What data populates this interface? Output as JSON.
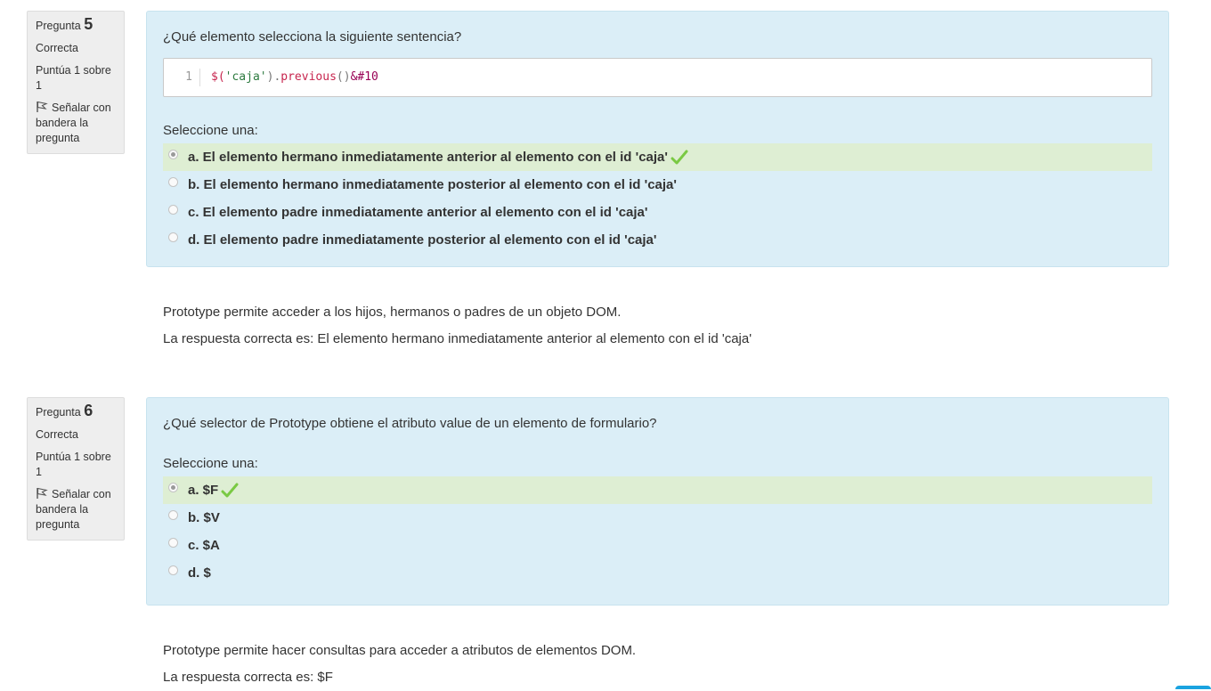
{
  "questions": [
    {
      "label": "Pregunta",
      "number": "5",
      "state": "Correcta",
      "grade": "Puntúa 1 sobre 1",
      "flag_label": "Señalar con bandera la pregunta",
      "text": "¿Qué elemento selecciona la siguiente sentencia?",
      "code": {
        "line_number": "1",
        "tokens": [
          "$(",
          "'caja'",
          ").",
          "previous",
          "()",
          "&#10"
        ]
      },
      "prompt": "Seleccione una:",
      "answers": [
        {
          "label": "a. El elemento hermano inmediatamente anterior al elemento con el id 'caja'",
          "selected": true,
          "correct": true
        },
        {
          "label": "b. El elemento hermano inmediatamente posterior al elemento con el id 'caja'",
          "selected": false,
          "correct": false
        },
        {
          "label": "c. El elemento padre inmediatamente anterior al elemento con el id 'caja'",
          "selected": false,
          "correct": false
        },
        {
          "label": "d. El elemento padre inmediatamente posterior al elemento con el id 'caja'",
          "selected": false,
          "correct": false
        }
      ],
      "feedback": "Prototype permite acceder a los hijos, hermanos o padres de un objeto DOM.",
      "right_answer": "La respuesta correcta es: El elemento hermano inmediatamente anterior al elemento con el id 'caja'"
    },
    {
      "label": "Pregunta",
      "number": "6",
      "state": "Correcta",
      "grade": "Puntúa 1 sobre 1",
      "flag_label": "Señalar con bandera la pregunta",
      "text": "¿Qué selector de Prototype obtiene el atributo value de un elemento de formulario?",
      "prompt": "Seleccione una:",
      "answers": [
        {
          "label": "a. $F",
          "selected": true,
          "correct": true
        },
        {
          "label": "b. $V",
          "selected": false,
          "correct": false
        },
        {
          "label": "c. $A",
          "selected": false,
          "correct": false
        },
        {
          "label": "d. $",
          "selected": false,
          "correct": false
        }
      ],
      "feedback": "Prototype permite hacer consultas para acceder a atributos de elementos DOM.",
      "right_answer": "La respuesta correcta es: $F"
    }
  ],
  "colors": {
    "formulation_bg": "#dbeef7",
    "correct_bg": "#deeed3",
    "check": "#7ac943",
    "info_bg": "#eeeeee"
  }
}
